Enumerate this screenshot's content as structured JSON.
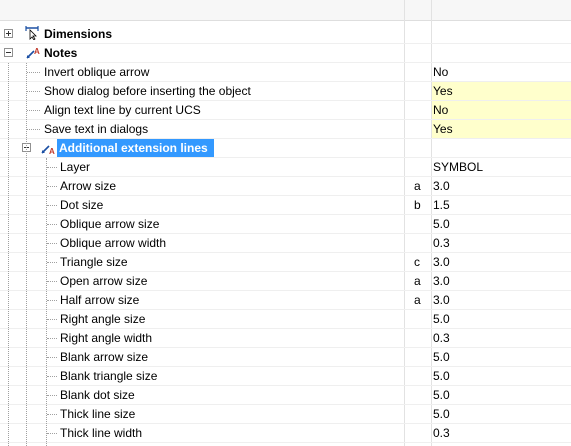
{
  "tree": {
    "dimensions": {
      "label": "Dimensions",
      "icon": "dimension-icon"
    },
    "notes": {
      "label": "Notes",
      "icon": "notes-icon"
    },
    "notes_props": [
      {
        "label": "Invert oblique arrow",
        "value": "No",
        "highlight": false
      },
      {
        "label": "Show dialog before inserting the object",
        "value": "Yes",
        "highlight": true
      },
      {
        "label": "Align text line by current UCS",
        "value": "No",
        "highlight": true
      },
      {
        "label": "Save text in dialogs",
        "value": "Yes",
        "highlight": true
      }
    ],
    "additional": {
      "label": "Additional extension lines",
      "icon": "extension-lines-icon"
    },
    "additional_props": [
      {
        "label": "Layer",
        "letter": "",
        "value": "SYMBOL"
      },
      {
        "label": "Arrow size",
        "letter": "a",
        "value": "3.0"
      },
      {
        "label": "Dot size",
        "letter": "b",
        "value": "1.5"
      },
      {
        "label": "Oblique arrow size",
        "letter": "",
        "value": "5.0"
      },
      {
        "label": "Oblique arrow width",
        "letter": "",
        "value": "0.3"
      },
      {
        "label": "Triangle size",
        "letter": "c",
        "value": "3.0"
      },
      {
        "label": "Open arrow size",
        "letter": "a",
        "value": "3.0"
      },
      {
        "label": "Half arrow size",
        "letter": "a",
        "value": "3.0"
      },
      {
        "label": "Right angle size",
        "letter": "",
        "value": "5.0"
      },
      {
        "label": "Right angle width",
        "letter": "",
        "value": "0.3"
      },
      {
        "label": "Blank arrow size",
        "letter": "",
        "value": "5.0"
      },
      {
        "label": "Blank triangle size",
        "letter": "",
        "value": "5.0"
      },
      {
        "label": "Blank dot size",
        "letter": "",
        "value": "5.0"
      },
      {
        "label": "Thick line size",
        "letter": "",
        "value": "5.0"
      },
      {
        "label": "Thick line width",
        "letter": "",
        "value": "0.3"
      }
    ]
  },
  "colors": {
    "selection": "#3399ff",
    "value_highlight": "#ffffcc"
  }
}
